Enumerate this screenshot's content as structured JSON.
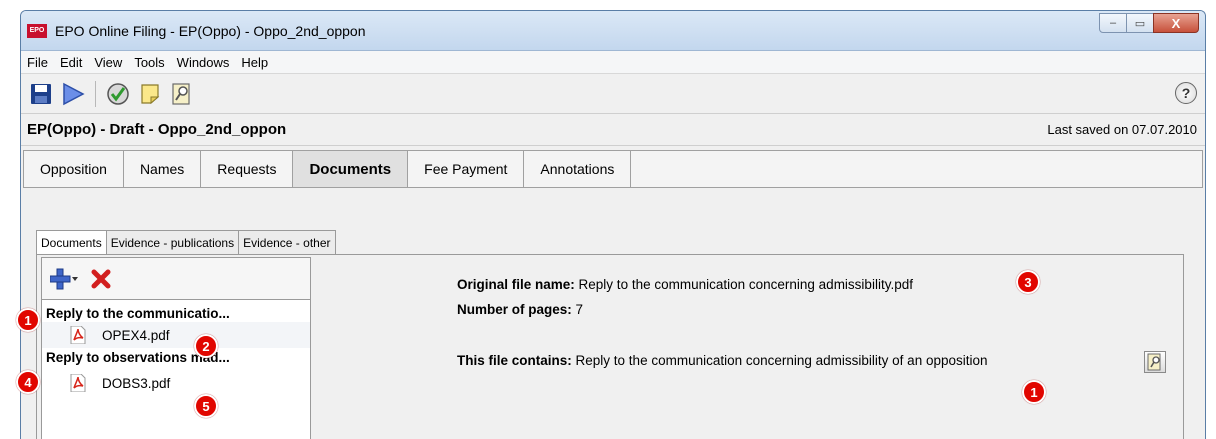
{
  "window": {
    "logo_text": "EPO",
    "title": "EPO Online Filing - EP(Oppo) - Oppo_2nd_oppon",
    "minimize_symbol": "–",
    "maximize_symbol": "▭",
    "close_symbol": "X"
  },
  "menu": [
    "File",
    "Edit",
    "View",
    "Tools",
    "Windows",
    "Help"
  ],
  "toolbar": {
    "icons": [
      "save-icon",
      "play-icon",
      "check-icon",
      "note-icon",
      "magnify-icon"
    ],
    "help_label": "?"
  },
  "doc_header": {
    "title": "EP(Oppo) - Draft - Oppo_2nd_oppon",
    "last_saved": "Last saved on 07.07.2010"
  },
  "main_tabs": [
    "Opposition",
    "Names",
    "Requests",
    "Documents",
    "Fee Payment",
    "Annotations"
  ],
  "main_tabs_active": "Documents",
  "sub_tabs": [
    "Documents",
    "Evidence - publications",
    "Evidence - other"
  ],
  "sub_tabs_active": "Documents",
  "left_pane": {
    "toolbar_icons": [
      "add-icon",
      "delete-icon"
    ],
    "groups": [
      {
        "title": "Reply to the communicatio...",
        "file": "OPEX4.pdf",
        "badge_group": "1",
        "badge_file": "2"
      },
      {
        "title": "Reply to observations mad...",
        "file": "DOBS3.pdf",
        "badge_group": "4",
        "badge_file": "5"
      }
    ]
  },
  "details": {
    "original_file_label": "Original file name:",
    "original_file_value": "Reply to the communication concerning admissibility.pdf",
    "pages_label": "Number of pages:",
    "pages_value": "7",
    "contains_label": "This file contains:",
    "contains_value": "Reply to the communication concerning admissibility of an opposition",
    "badge_filename": "3",
    "badge_contains": "1"
  },
  "colors": {
    "badge": "#e10600",
    "title_bar": "#c3d7ee",
    "pdf_red": "#d7261b"
  }
}
